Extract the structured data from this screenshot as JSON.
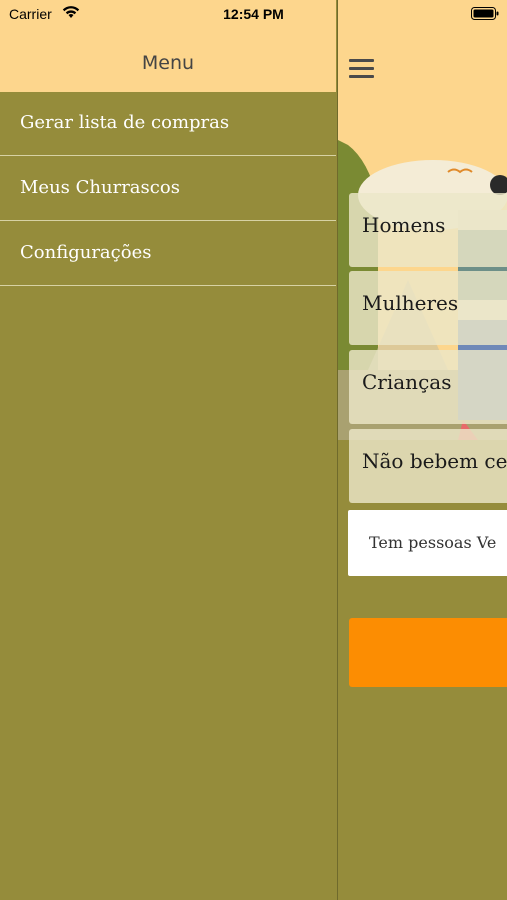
{
  "status_bar": {
    "carrier": "Carrier",
    "time": "12:54 PM",
    "wifi_icon": "wifi-icon",
    "battery_icon": "battery-icon"
  },
  "drawer": {
    "title": "Menu",
    "items": [
      {
        "label": "Gerar lista de compras"
      },
      {
        "label": "Meus Churrascos"
      },
      {
        "label": "Configurações"
      }
    ]
  },
  "main": {
    "menu_icon": "hamburger-icon",
    "fields": [
      {
        "label": "Homens"
      },
      {
        "label": "Mulheres"
      },
      {
        "label": "Crianças"
      },
      {
        "label": "Não bebem ce"
      }
    ],
    "vegan_label": "Tem pessoas Ve"
  },
  "colors": {
    "header_bg": "#fdd68d",
    "drawer_bg": "#958c3b",
    "accent_button": "#fc8d02",
    "menu_text": "#ffffff"
  }
}
